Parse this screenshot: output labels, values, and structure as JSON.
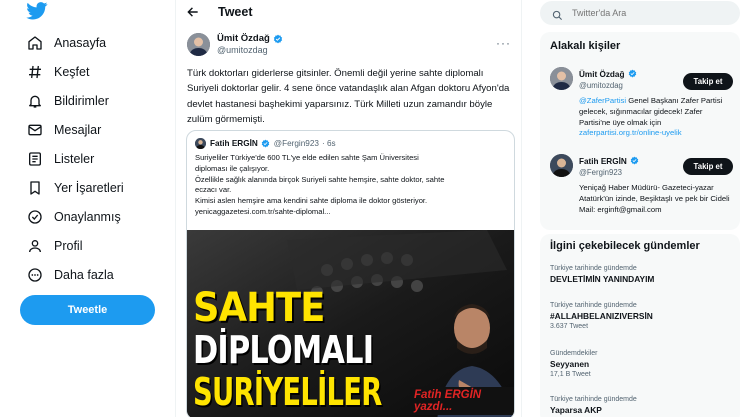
{
  "nav": {
    "items": [
      {
        "label": "Anasayfa",
        "icon": "home-icon"
      },
      {
        "label": "Keşfet",
        "icon": "hashtag-icon"
      },
      {
        "label": "Bildirimler",
        "icon": "bell-icon"
      },
      {
        "label": "Mesajlar",
        "icon": "mail-icon"
      },
      {
        "label": "Listeler",
        "icon": "list-icon"
      },
      {
        "label": "Yer İşaretleri",
        "icon": "bookmark-icon"
      },
      {
        "label": "Onaylanmış",
        "icon": "verified-icon"
      },
      {
        "label": "Profil",
        "icon": "profile-icon"
      },
      {
        "label": "Daha fazla",
        "icon": "more-circle-icon"
      }
    ],
    "tweet_button": "Tweetle"
  },
  "header": {
    "title": "Tweet"
  },
  "tweet": {
    "author_name": "Ümit Özdağ",
    "author_handle": "@umitozdag",
    "text": "Türk doktorları giderlerse gitsinler. Önemli değil yerine sahte diplomalı Suriyeli doktorlar gelir. 4 sene önce vatandaşlık alan Afgan doktoru Afyon'da devlet hastanesi başhekimi yaparsınız. Türk Milleti uzun zamandır böyle zulüm görmemişti.",
    "quote": {
      "author_name": "Fatih ERGİN",
      "author_handle": "@Fergin923",
      "time": "· 6s",
      "lines": [
        "Suriyeliler Türkiye'de 600 TL'ye elde edilen sahte Şam Üniversitesi",
        "diploması ile çalışıyor.",
        "Özellikle sağlık alanında birçok Suriyeli sahte hemşire, sahte doktor, sahte",
        "eczacı var.",
        "Kimisi aslen hemşire ama kendini sahte diploma ile doktor gösteriyor.",
        "yenicaggazetesi.com.tr/sahte-diplomal..."
      ],
      "image": {
        "line1": "SAHTE",
        "line2": "DİPLOMALI",
        "line3": "SURİYELİLER",
        "caption": "Fatih ERGİN yazdı..."
      }
    }
  },
  "search": {
    "placeholder": "Twitter'da Ara"
  },
  "related": {
    "title": "Alakalı kişiler",
    "people": [
      {
        "name": "Ümit Özdağ",
        "handle": "@umitozdag",
        "follow": "Takip et",
        "bio_link": "@ZaferPartisi",
        "bio": " Genel Başkanı Zafer Partisi gelecek, sığınmacılar gidecek! Zafer Partisi'ne üye olmak için ",
        "bio_url": "zaferpartisi.org.tr/online-uyelik"
      },
      {
        "name": "Fatih ERGİN",
        "handle": "@Fergin923",
        "follow": "Takip et",
        "bio": "Yeniçağ Haber Müdürü- Gazeteci-yazar Atatürk'ün izinde, Beşiktaşlı ve pek bir Cideli Mail: erginft@gmail.com"
      }
    ]
  },
  "trends": {
    "title": "İlgini çekebilecek gündemler",
    "items": [
      {
        "context": "Türkiye tarihinde gündemde",
        "name": "DEVLETİMİN YANINDAYIM",
        "count": ""
      },
      {
        "context": "Türkiye tarihinde gündemde",
        "name": "#ALLAHBELANIZIVERSİN",
        "count": "3.637 Tweet"
      },
      {
        "context": "Gündemdekiler",
        "name": "Seyyanen",
        "count": "17,1 B Tweet"
      },
      {
        "context": "Türkiye tarihinde gündemde",
        "name": "Yaparsa AKP",
        "count": ""
      }
    ]
  },
  "colors": {
    "brand": "#1d9bf0",
    "text": "#0f1419",
    "muted": "#536471",
    "yellow": "#ffe400"
  }
}
